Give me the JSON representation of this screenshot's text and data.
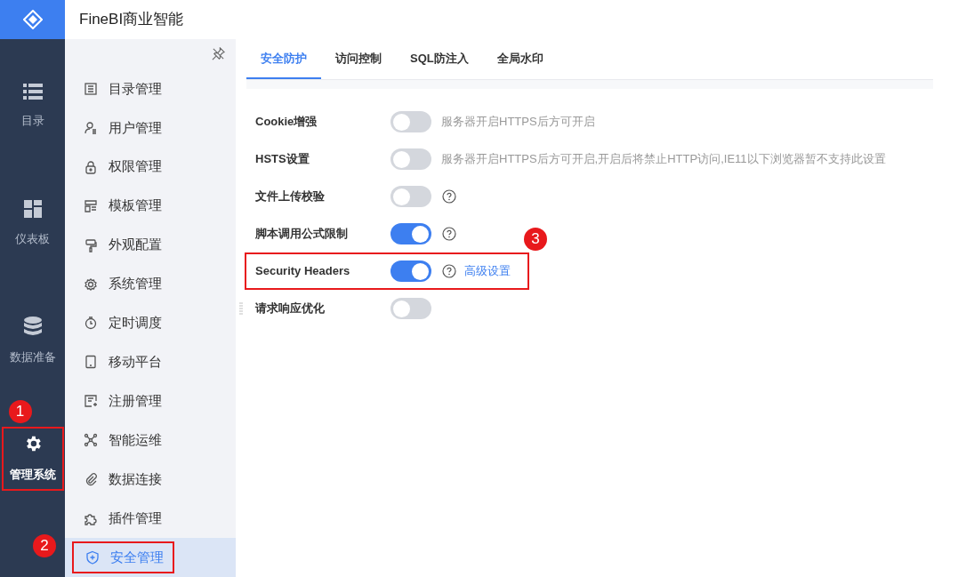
{
  "app_title": "FineBI商业智能",
  "rail": [
    {
      "label": "目录",
      "kind": "list",
      "selected": false
    },
    {
      "label": "仪表板",
      "kind": "grid",
      "selected": false
    },
    {
      "label": "数据准备",
      "kind": "database",
      "selected": false
    },
    {
      "label": "管理系统",
      "kind": "gear",
      "selected": true,
      "highlighted": true,
      "annotation": "1"
    }
  ],
  "sidebar": {
    "items": [
      {
        "label": "目录管理",
        "kind": "doc",
        "selected": false
      },
      {
        "label": "用户管理",
        "kind": "user",
        "selected": false
      },
      {
        "label": "权限管理",
        "kind": "lock",
        "selected": false
      },
      {
        "label": "模板管理",
        "kind": "template",
        "selected": false
      },
      {
        "label": "外观配置",
        "kind": "brush",
        "selected": false
      },
      {
        "label": "系统管理",
        "kind": "gear",
        "selected": false
      },
      {
        "label": "定时调度",
        "kind": "timer",
        "selected": false
      },
      {
        "label": "移动平台",
        "kind": "phone",
        "selected": false
      },
      {
        "label": "注册管理",
        "kind": "register",
        "selected": false
      },
      {
        "label": "智能运维",
        "kind": "nodes",
        "selected": false
      },
      {
        "label": "数据连接",
        "kind": "clip",
        "selected": false
      },
      {
        "label": "插件管理",
        "kind": "puzzle",
        "selected": false
      },
      {
        "label": "安全管理",
        "kind": "shield",
        "selected": true,
        "highlighted": true,
        "annotation": "2"
      }
    ]
  },
  "tabs": [
    {
      "label": "安全防护",
      "selected": true
    },
    {
      "label": "访问控制",
      "selected": false
    },
    {
      "label": "SQL防注入",
      "selected": false
    },
    {
      "label": "全局水印",
      "selected": false
    }
  ],
  "settings": [
    {
      "label": "Cookie增强",
      "on": false,
      "hint": "服务器开启HTTPS后方可开启"
    },
    {
      "label": "HSTS设置",
      "on": false,
      "hint": "服务器开启HTTPS后方可开启,开启后将禁止HTTP访问,IE11以下浏览器暂不支持此设置"
    },
    {
      "label": "文件上传校验",
      "on": false,
      "help": true
    },
    {
      "label": "脚本调用公式限制",
      "on": true,
      "help": true
    },
    {
      "label": "Security Headers",
      "on": true,
      "help": true,
      "link": "高级设置",
      "highlighted": true,
      "annotation": "3"
    },
    {
      "label": "请求响应优化",
      "on": false
    }
  ]
}
